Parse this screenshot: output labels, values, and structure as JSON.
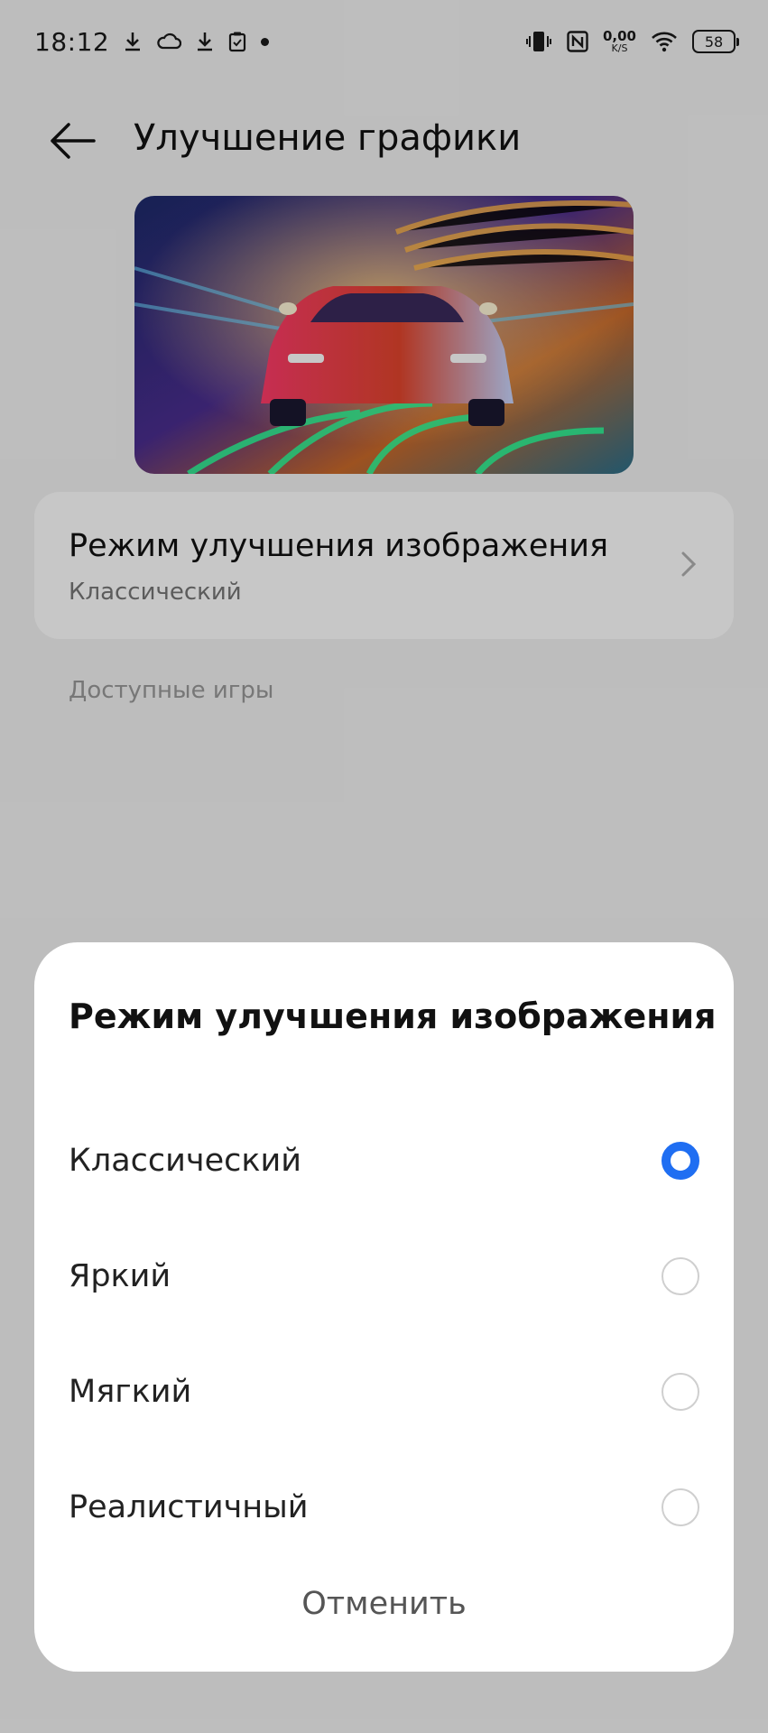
{
  "status_bar": {
    "time": "18:12",
    "net_speed_value": "0,00",
    "net_speed_unit": "K/S",
    "battery": "58",
    "left_icons": [
      "download-icon",
      "cloud-icon",
      "download-icon",
      "clipboard-check-icon",
      "dot-icon"
    ],
    "right_icons": [
      "vibrate-icon",
      "nfc-icon",
      "wifi-icon",
      "battery-icon"
    ]
  },
  "header": {
    "title": "Улучшение графики",
    "back_icon": "arrow-left-icon"
  },
  "settings": {
    "mode_label": "Режим улучшения изображения",
    "mode_value": "Классический",
    "available_games_label": "Доступные игры"
  },
  "dialog": {
    "title": "Режим улучшения изображения",
    "options": [
      {
        "label": "Классический",
        "selected": true
      },
      {
        "label": "Яркий",
        "selected": false
      },
      {
        "label": "Мягкий",
        "selected": false
      },
      {
        "label": "Реалистичный",
        "selected": false
      }
    ],
    "cancel_label": "Отменить",
    "accent_color": "#1f6ef2"
  }
}
